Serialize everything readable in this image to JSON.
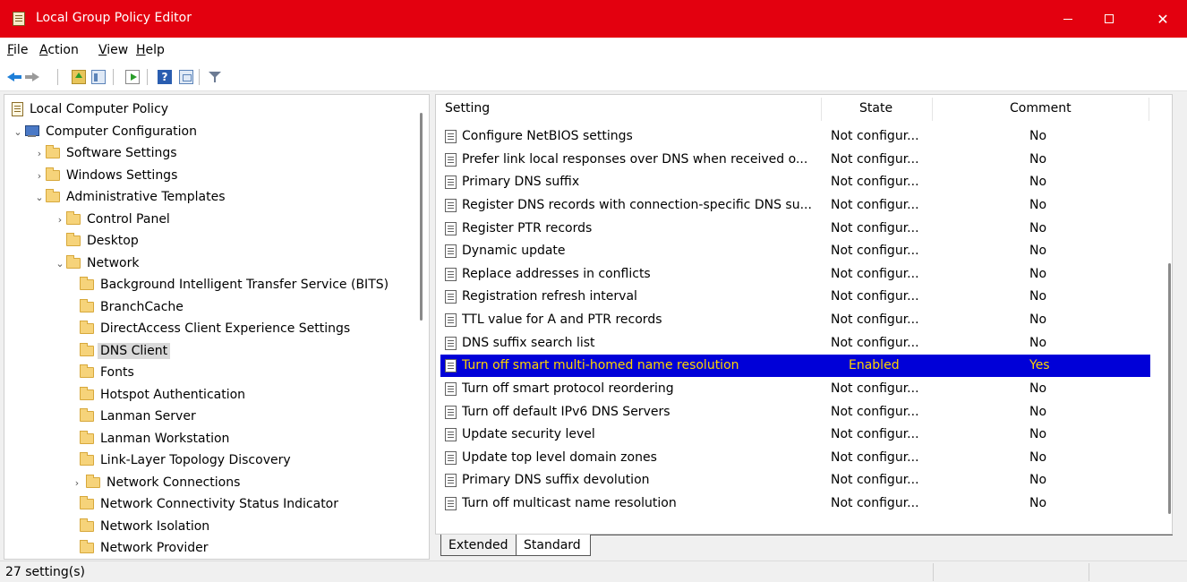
{
  "window": {
    "title": "Local Group Policy Editor"
  },
  "menu": [
    "File",
    "Action",
    "View",
    "Help"
  ],
  "toolbar": {
    "icons": [
      "back-arrow-icon",
      "forward-arrow-icon",
      "up-folder-icon",
      "show-hide-tree-icon",
      "export-list-icon",
      "help-icon",
      "properties-icon",
      "filter-icon"
    ],
    "help_glyph": "?"
  },
  "tree": [
    {
      "label": "Local Computer Policy",
      "chevron": "",
      "icon": "policy"
    },
    {
      "label": "Computer Configuration",
      "chevron": "⌄",
      "icon": "computer"
    },
    {
      "label": "Software Settings",
      "chevron": "›",
      "icon": "folder"
    },
    {
      "label": "Windows Settings",
      "chevron": "›",
      "icon": "folder"
    },
    {
      "label": "Administrative Templates",
      "chevron": "⌄",
      "icon": "folder"
    },
    {
      "label": "Control Panel",
      "chevron": "›",
      "icon": "folder"
    },
    {
      "label": "Desktop",
      "chevron": "",
      "icon": "folder"
    },
    {
      "label": "Network",
      "chevron": "⌄",
      "icon": "folder"
    },
    {
      "label": "Background Intelligent Transfer Service (BITS)",
      "chevron": "",
      "icon": "folder"
    },
    {
      "label": "BranchCache",
      "chevron": "",
      "icon": "folder"
    },
    {
      "label": "DirectAccess Client Experience Settings",
      "chevron": "",
      "icon": "folder"
    },
    {
      "label": "DNS Client",
      "chevron": "",
      "icon": "folder",
      "selected": true
    },
    {
      "label": "Fonts",
      "chevron": "",
      "icon": "folder"
    },
    {
      "label": "Hotspot Authentication",
      "chevron": "",
      "icon": "folder"
    },
    {
      "label": "Lanman Server",
      "chevron": "",
      "icon": "folder"
    },
    {
      "label": "Lanman Workstation",
      "chevron": "",
      "icon": "folder"
    },
    {
      "label": "Link-Layer Topology Discovery",
      "chevron": "",
      "icon": "folder"
    },
    {
      "label": "Network Connections",
      "chevron": "›",
      "icon": "folder"
    },
    {
      "label": "Network Connectivity Status Indicator",
      "chevron": "",
      "icon": "folder"
    },
    {
      "label": "Network Isolation",
      "chevron": "",
      "icon": "folder"
    },
    {
      "label": "Network Provider",
      "chevron": "",
      "icon": "folder"
    }
  ],
  "list": {
    "columns": {
      "setting": "Setting",
      "state": "State",
      "comment": "Comment"
    },
    "rows": [
      {
        "setting": "Configure NetBIOS settings",
        "state": "Not configur...",
        "comment": "No"
      },
      {
        "setting": "Prefer link local responses over DNS when received o...",
        "state": "Not configur...",
        "comment": "No"
      },
      {
        "setting": "Primary DNS suffix",
        "state": "Not configur...",
        "comment": "No"
      },
      {
        "setting": "Register DNS records with connection-specific DNS su...",
        "state": "Not configur...",
        "comment": "No"
      },
      {
        "setting": "Register PTR records",
        "state": "Not configur...",
        "comment": "No"
      },
      {
        "setting": "Dynamic update",
        "state": "Not configur...",
        "comment": "No"
      },
      {
        "setting": "Replace addresses in conflicts",
        "state": "Not configur...",
        "comment": "No"
      },
      {
        "setting": "Registration refresh interval",
        "state": "Not configur...",
        "comment": "No"
      },
      {
        "setting": "TTL value for A and PTR records",
        "state": "Not configur...",
        "comment": "No"
      },
      {
        "setting": "DNS suffix search list",
        "state": "Not configur...",
        "comment": "No"
      },
      {
        "setting": "Turn off smart multi-homed name resolution",
        "state": "Enabled",
        "comment": "Yes",
        "highlighted": true
      },
      {
        "setting": "Turn off smart protocol reordering",
        "state": "Not configur...",
        "comment": "No"
      },
      {
        "setting": "Turn off default IPv6 DNS Servers",
        "state": "Not configur...",
        "comment": "No"
      },
      {
        "setting": "Update security level",
        "state": "Not configur...",
        "comment": "No"
      },
      {
        "setting": "Update top level domain zones",
        "state": "Not configur...",
        "comment": "No"
      },
      {
        "setting": "Primary DNS suffix devolution",
        "state": "Not configur...",
        "comment": "No"
      },
      {
        "setting": "Turn off multicast name resolution",
        "state": "Not configur...",
        "comment": "No"
      }
    ]
  },
  "tabs": [
    "Extended",
    "Standard"
  ],
  "status": {
    "text": "27 setting(s)"
  },
  "colors": {
    "titlebar": "#e3000f",
    "highlight_bg": "#0000d8",
    "highlight_text": "#ffd400"
  }
}
